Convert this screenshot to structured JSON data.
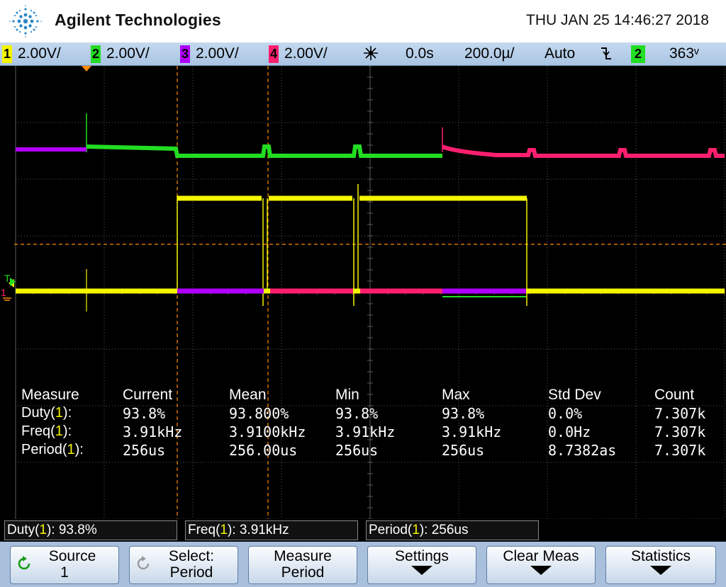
{
  "header": {
    "brand": "Agilent Technologies",
    "datetime": "THU JAN 25 14:46:27 2018"
  },
  "statusbar": {
    "channels": [
      {
        "num": "1",
        "scale": "2.00V/",
        "color": "#f5f500"
      },
      {
        "num": "2",
        "scale": "2.00V/",
        "color": "#22dd22"
      },
      {
        "num": "3",
        "scale": "2.00V/",
        "color": "#b000ff"
      },
      {
        "num": "4",
        "scale": "2.00V/",
        "color": "#ff1f6e"
      }
    ],
    "delay": "0.0s",
    "timebase": "200.0µ/",
    "trigger_mode": "Auto",
    "trigger_source": "2",
    "trigger_level": "363ᵛ"
  },
  "markers": {
    "trigger": "T",
    "ch1_ground": "1"
  },
  "measurements": {
    "headers": [
      "Measure",
      "Current",
      "Mean",
      "Min",
      "Max",
      "Std Dev",
      "Count"
    ],
    "rows": [
      {
        "name": "Duty",
        "source": "1",
        "suffix": "):",
        "current": "93.8%",
        "mean": "93.800%",
        "min": "93.8%",
        "max": "93.8%",
        "std": "0.0%",
        "count": "7.307k"
      },
      {
        "name": "Freq",
        "source": "1",
        "suffix": "):",
        "current": "3.91kHz",
        "mean": "3.9100kHz",
        "min": "3.91kHz",
        "max": "3.91kHz",
        "std": "0.0Hz",
        "count": "7.307k"
      },
      {
        "name": "Period",
        "source": "1",
        "suffix": "):",
        "current": "256us",
        "mean": "256.00us",
        "min": "256us",
        "max": "256us",
        "std": "8.7382as",
        "count": "7.307k"
      }
    ]
  },
  "summary": [
    {
      "name": "Duty",
      "source": "1",
      "value": "): 93.8%"
    },
    {
      "name": "Freq",
      "source": "1",
      "value": "): 3.91kHz"
    },
    {
      "name": "Period",
      "source": "1",
      "value": "): 256us"
    }
  ],
  "softkeys": {
    "source": {
      "line1": "Source",
      "line2": "1"
    },
    "select": {
      "line1": "Select:",
      "line2": "Period"
    },
    "measure": {
      "line1": "Measure",
      "line2": "Period"
    },
    "settings": {
      "line1": "Settings"
    },
    "clear": {
      "line1": "Clear Meas"
    },
    "statistics": {
      "line1": "Statistics"
    }
  },
  "colors": {
    "ch1": "#f5f500",
    "ch2": "#22dd22",
    "ch3": "#b000ff",
    "ch4": "#ff1f6e",
    "cursor": "#ff8a00",
    "grid": "#5a5a5a"
  }
}
